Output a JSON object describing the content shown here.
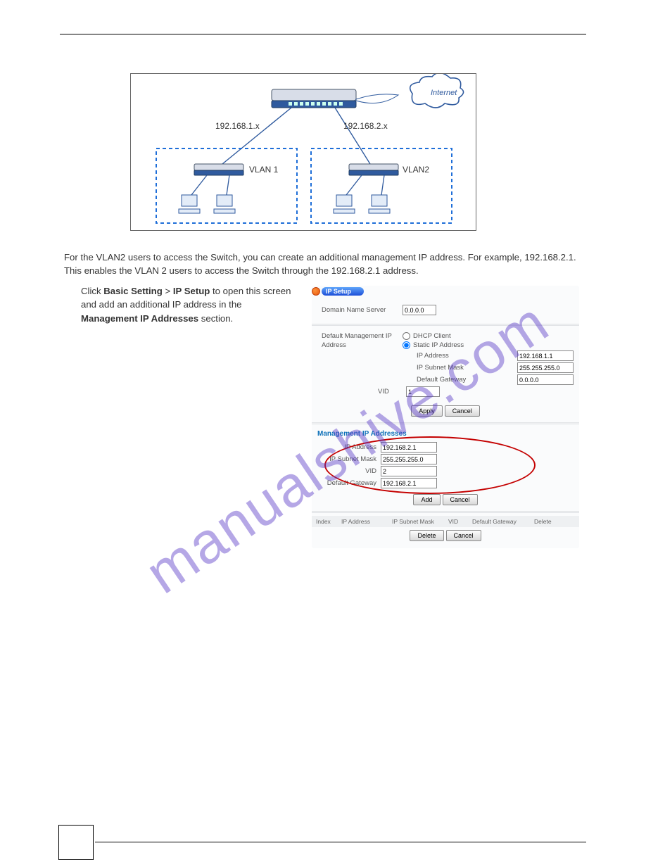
{
  "watermark": "manualshive.com",
  "diagram": {
    "internet": "Internet",
    "net1": "192.168.1.x",
    "net2": "192.168.2.x",
    "vlan1": "VLAN 1",
    "vlan2": "VLAN2"
  },
  "text": {
    "para1": "For the VLAN2 users to access the Switch, you can create an additional management IP address. For example, 192.168.2.1. This enables the VLAN 2 users to access the Switch through the 192.168.2.1 address.",
    "para2_prefix": "Click ",
    "para2_link1": "Basic Setting",
    "para2_mid": " > ",
    "para2_link2": "IP Setup",
    "para2_suffix": " to open this screen and add an additional IP address in the ",
    "para2_bold": "Management IP Addresses",
    "para2_end": " section."
  },
  "panel": {
    "title": "IP Setup",
    "dns_label": "Domain Name Server",
    "dns_value": "0.0.0.0",
    "mgmt_label1": "Default Management IP",
    "mgmt_label2": "Address",
    "dhcp": "DHCP Client",
    "static": "Static IP Address",
    "ip_label": "IP Address",
    "def_ip": "192.168.1.1",
    "mask_label": "IP Subnet Mask",
    "def_mask": "255.255.255.0",
    "gw_label": "Default Gateway",
    "def_gw": "0.0.0.0",
    "vid_label": "VID",
    "def_vid": "1",
    "apply": "Apply",
    "cancel": "Cancel",
    "section2": "Management IP Addresses",
    "m_ip": "192.168.2.1",
    "m_mask": "255.255.255.0",
    "m_vid": "2",
    "m_gw": "192.168.2.1",
    "add": "Add",
    "th_index": "Index",
    "th_ip": "IP Address",
    "th_mask": "IP Subnet Mask",
    "th_vid": "VID",
    "th_gw": "Default Gateway",
    "th_del": "Delete",
    "delete": "Delete"
  }
}
